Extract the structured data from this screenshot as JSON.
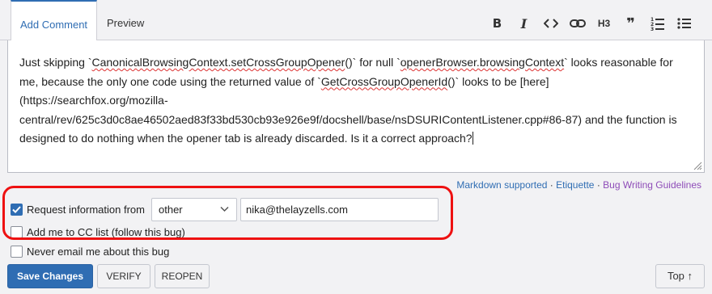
{
  "tabs": {
    "add_comment": "Add Comment",
    "preview": "Preview"
  },
  "toolbar": {
    "bold": "B",
    "italic": "I",
    "heading": "H3",
    "quote": "❞",
    "icons": [
      "bold-icon",
      "italic-icon",
      "code-icon",
      "link-icon",
      "heading-icon",
      "quote-icon",
      "ordered-list-icon",
      "bullet-list-icon"
    ]
  },
  "comment": {
    "t1": "Just skipping `",
    "s1": "CanonicalBrowsingContext.setCrossGroupOpener",
    "t2": "()` for null `",
    "s2": "openerBrowser.browsingContext",
    "t3": "` looks reasonable for me, because the only one code using the returned value of `",
    "s3": "GetCrossGroupOpenerId",
    "t4": "()` looks to be [here](https://searchfox.org/mozilla-central/rev/625c3d0c8ae46502aed83f33bd530cb93e926e9f/docshell/base/nsDSURIContentListener.cpp#86-87) and the function is designed to do nothing when the opener tab is already discarded. Is it a correct approach?"
  },
  "links": {
    "markdown": "Markdown supported",
    "sep1": " · ",
    "etiquette": "Etiquette",
    "sep2": " · ",
    "guidelines": "Bug Writing Guidelines"
  },
  "needinfo": {
    "label": "Request information from",
    "checked": true,
    "select_value": "other",
    "email_value": "nika@thelayzells.com"
  },
  "cc": {
    "label": "Add me to CC list (follow this bug)",
    "checked": false
  },
  "never_email": {
    "label": "Never email me about this bug",
    "checked": false
  },
  "buttons": {
    "save": "Save Changes",
    "verify": "VERIFY",
    "reopen": "REOPEN",
    "top": "Top ↑"
  },
  "colors": {
    "accent": "#2f6db3",
    "highlight": "#e11111",
    "guidelines_link": "#8e4cb8"
  }
}
